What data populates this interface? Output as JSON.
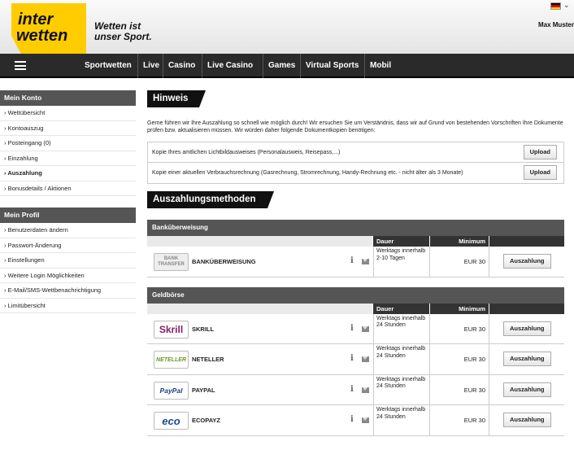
{
  "header": {
    "logo_line1": "inter",
    "logo_line2": "wetten",
    "slogan_line1": "Wetten ist",
    "slogan_line2": "unser Sport.",
    "user": "Max Muster",
    "flag_colors": [
      "#000000",
      "#dd0000",
      "#ffce00"
    ]
  },
  "nav": {
    "menu_icon": "hamburger-icon",
    "items": [
      "Sportwetten",
      "Live",
      "Casino",
      "Live Casino",
      "Games",
      "Virtual Sports",
      "Mobil"
    ]
  },
  "sidebar": {
    "konto_title": "Mein Konto",
    "konto_items": [
      "Wettübersicht",
      "Kontoauszug",
      "Posteingang (0)",
      "Einzahlung",
      "Auszahlung",
      "Bonusdetails / Aktionen"
    ],
    "profil_title": "Mein Profil",
    "profil_items": [
      "Benutzerdaten ändern",
      "Passwort-Änderung",
      "Einstellungen",
      "Weitere Login Möglichkeiten",
      "E-Mail/SMS-Wettbenachrichtigung",
      "Limitübersicht"
    ]
  },
  "hinweis": {
    "title": "Hinweis",
    "text": "Gerne führen wir Ihre Auszahlung so schnell wie möglich durch! Wir ersuchen Sie um Verständnis, dass wir auf Grund von bestehenden Vorschriften Ihre Dokumente prüfen bzw. aktualisieren müssen. Wir würden daher folgende Dokumentkopien benötigen:",
    "docs": [
      {
        "label": "Kopie Ihres amtlichen Lichtbildausweises (Personalausweis, Reisepass,...)",
        "button": "Upload"
      },
      {
        "label": "Kopie einer aktuellen Verbrauchsrechnung (Gasrechnung, Stromrechnung, Handy-Rechnung etc. - nicht älter als 3 Monate)",
        "button": "Upload"
      }
    ]
  },
  "methods": {
    "title": "Auszahlungsmethoden",
    "col_dauer": "Dauer",
    "col_minimum": "Minimum",
    "info_icon": "info-icon",
    "mail_icon": "mail-icon",
    "sections": [
      {
        "title": "Banküberweisung",
        "rows": [
          {
            "logo": "BANK TRANSFER",
            "name": "BANKÜBERWEISUNG",
            "dauer": "Werktags innerhalb 2-10 Tagen",
            "minimum": "EUR 30",
            "button": "Auszahlung"
          }
        ]
      },
      {
        "title": "Geldbörse",
        "rows": [
          {
            "logo": "Skrill",
            "name": "SKRILL",
            "dauer": "Werktags innerhalb 24 Stunden",
            "minimum": "EUR 30",
            "button": "Auszahlung"
          },
          {
            "logo": "NETELLER",
            "name": "NETELLER",
            "dauer": "Werktags innerhalb 24 Stunden",
            "minimum": "EUR 30",
            "button": "Auszahlung"
          },
          {
            "logo": "PayPal",
            "name": "PAYPAL",
            "dauer": "Werktags innerhalb 24 Stunden",
            "minimum": "EUR 30",
            "button": "Auszahlung"
          },
          {
            "logo": "eco",
            "name": "ECOPAYZ",
            "dauer": "Werktags innerhalb 24 Stunden",
            "minimum": "EUR 30",
            "button": "Auszahlung"
          }
        ]
      }
    ]
  }
}
